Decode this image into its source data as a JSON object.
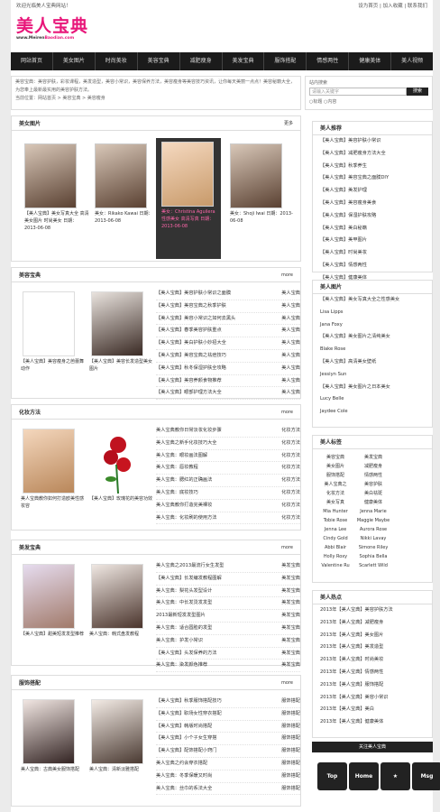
{
  "top": {
    "left": "欢迎光临美人宝典网站！",
    "right": "设为首页 | 加入收藏 | 联系我们"
  },
  "logo": {
    "title": "美人宝典",
    "sub_a": "www.Meiren",
    "sub_b": "Baodian.com"
  },
  "nav": [
    "网站首页",
    "美女图片",
    "时尚美妆",
    "美容宝典",
    "减肥瘦身",
    "美发宝典",
    "服饰搭配",
    "情感两性",
    "健康美体",
    "美人视频"
  ],
  "crumb": "美容宝典：美容护肤，彩妆课程，美发造型，美容小常识，美容保养方法，美容瘦身等美容技巧资讯，让你每天美丽一点点！美容秘籍大全，为您奉上最新最实用的美容护肤方法。",
  "crumb2": "当前位置：网站首页 > 美容宝典 > 美容瘦身",
  "search": {
    "title": "站内搜索",
    "placeholder": "请输入关键字",
    "button": "搜索",
    "opts": "○标题  ○内容"
  },
  "s1": {
    "title": "美女图片",
    "more": "更多"
  },
  "cards": [
    {
      "t": "【美人宝典】美女写真大全 高清美女图片 时尚美女 日期：2013-06-08"
    },
    {
      "t": "美女：Rikako Kawai 日期：2013-06-08"
    },
    {
      "t": "美女：Christina Aguilera 性感美女 高清写真 日期：2013-06-08"
    },
    {
      "t": "美女：Shoji Iwai 日期：2013-06-08"
    }
  ],
  "s2": {
    "title": "美容宝典",
    "more": "more"
  },
  "s2caps": [
    "【美人宝典】美容瘦身之芭蕾舞动作",
    "【美人宝典】美容长发造型美女图片"
  ],
  "s2list": [
    [
      "【美人宝典】美容护肤小常识之面膜",
      "美人宝典"
    ],
    [
      "【美人宝典】美容宝典之秋季护肤",
      "美人宝典"
    ],
    [
      "【美人宝典】美容小常识之如何去黑头",
      "美人宝典"
    ],
    [
      "【美人宝典】春季美容护肤重点",
      "美人宝典"
    ],
    [
      "【美人宝典】美白护肤小妙招大全",
      "美人宝典"
    ],
    [
      "【美人宝典】美容宝典之祛痘技巧",
      "美人宝典"
    ],
    [
      "【美人宝典】秋冬保湿护肤全攻略",
      "美人宝典"
    ],
    [
      "【美人宝典】美容养颜食物推荐",
      "美人宝典"
    ],
    [
      "【美人宝典】眼部护理方法大全",
      "美人宝典"
    ]
  ],
  "s3": {
    "title": "化妆方法",
    "more": "more"
  },
  "s3caps": [
    "美人宝典教你如何打造欧美性感妆容",
    "【美人宝典】玫瑰花的美容功效"
  ],
  "s3list": [
    [
      "美人宝典教你日常淡妆化妆步骤",
      "化妆方法"
    ],
    [
      "美人宝典之新手化妆技巧大全",
      "化妆方法"
    ],
    [
      "美人宝典：眼妆画法图解",
      "化妆方法"
    ],
    [
      "美人宝典：唇妆教程",
      "化妆方法"
    ],
    [
      "美人宝典：腮红的正确画法",
      "化妆方法"
    ],
    [
      "美人宝典：底妆技巧",
      "化妆方法"
    ],
    [
      "美人宝典教你打造完美裸妆",
      "化妆方法"
    ],
    [
      "美人宝典：化妆刷的使用方法",
      "化妆方法"
    ]
  ],
  "s4": {
    "title": "美发宝典",
    "more": "more"
  },
  "s4caps": [
    "【美人宝典】甜美短发发型推荐",
    "美人宝典：韩式盘发教程"
  ],
  "s4list": [
    [
      "美人宝典之2013最流行女生发型",
      "美发宝典"
    ],
    [
      "【美人宝典】长发编发教程图解",
      "美发宝典"
    ],
    [
      "美人宝典：梨花头发型设计",
      "美发宝典"
    ],
    [
      "美人宝典：中长发烫发发型",
      "美发宝典"
    ],
    [
      "2013最新短发发型图片",
      "美发宝典"
    ],
    [
      "美人宝典：适合圆脸的发型",
      "美发宝典"
    ],
    [
      "美人宝典：护发小常识",
      "美发宝典"
    ],
    [
      "【美人宝典】头发保养的方法",
      "美发宝典"
    ],
    [
      "美人宝典：染发颜色推荐",
      "美发宝典"
    ]
  ],
  "s5": {
    "title": "服饰搭配",
    "more": "more"
  },
  "s5caps": [
    "美人宝典：古典美女服饰搭配",
    "美人宝典：清新淡雅搭配"
  ],
  "s5list": [
    [
      "【美人宝典】秋季服饰搭配技巧",
      "服饰搭配"
    ],
    [
      "【美人宝典】职场女性穿衣搭配",
      "服饰搭配"
    ],
    [
      "【美人宝典】韩版时尚搭配",
      "服饰搭配"
    ],
    [
      "【美人宝典】小个子女生穿搭",
      "服饰搭配"
    ],
    [
      "【美人宝典】配饰搭配小窍门",
      "服饰搭配"
    ],
    [
      "美人宝典之约会穿衣搭配",
      "服饰搭配"
    ],
    [
      "美人宝典：冬季保暖又时尚",
      "服饰搭配"
    ],
    [
      "美人宝典：丝巾的系法大全",
      "服饰搭配"
    ]
  ],
  "side1": {
    "title": "美人推荐",
    "items": [
      "【美人宝典】美容护肤小常识",
      "【美人宝典】减肥瘦身方法大全",
      "【美人宝典】秋季养生",
      "【美人宝典】美容宝典之面膜DIY",
      "【美人宝典】美发护理",
      "【美人宝典】美容瘦身美食",
      "【美人宝典】保湿护肤攻略",
      "【美人宝典】美白秘籍",
      "【美人宝典】美甲图片",
      "【美人宝典】时尚美妆",
      "【美人宝典】情感两性",
      "【美人宝典】健康美体"
    ]
  },
  "side2": {
    "title": "美人图片",
    "items": [
      "【美人宝典】美女写真大全之性感美女",
      "Lisa Lipps",
      "Jana Foxy",
      "【美人宝典】美女图片之清纯美女",
      "Blake Rose",
      "【美人宝典】高清美女壁纸",
      "Jessiyn Sun",
      "【美人宝典】美女图片之日本美女",
      "Lucy Belle",
      "Jaydee Cole"
    ]
  },
  "side3": {
    "title": "美人标签",
    "tags": [
      "美容宝典",
      "美发宝典",
      "美女图片",
      "减肥瘦身",
      "服饰搭配",
      "情感两性",
      "美人宝典之",
      "美容护肤",
      "化妆方法",
      "美白祛斑",
      "美女写真",
      "健康美体",
      "Mia Hunter",
      "Jenna Marie",
      "Tobie Rose",
      "Maggie Maybe",
      "Jenna Lee",
      "Aurora Rose",
      "Cindy Gold",
      "Nikki Lavay",
      "Abbi Blair",
      "Simone Riley",
      "Holly Roxy",
      "Sophia Bella",
      "Valentine Ru",
      "Scarlett Wild"
    ]
  },
  "side4": {
    "title": "美人热点",
    "items": [
      "2013年【美人宝典】美容护肤方法",
      "2013年【美人宝典】减肥瘦身",
      "2013年【美人宝典】美女图片",
      "2013年【美人宝典】美发造型",
      "2013年【美人宝典】时尚美妆",
      "2013年【美人宝典】情感两性",
      "2013年【美人宝典】服饰搭配",
      "2013年【美人宝典】美容小常识",
      "2013年【美人宝典】美白",
      "2013年【美人宝典】健康美体"
    ]
  },
  "follow": "关注美人宝典",
  "btns": [
    "Top",
    "Home",
    "★",
    "Msg"
  ]
}
